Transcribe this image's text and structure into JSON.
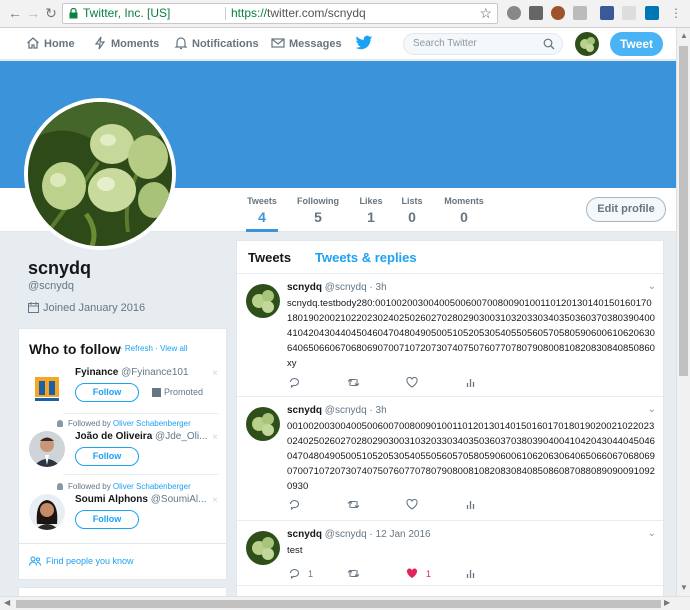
{
  "browser": {
    "secure_label": "Twitter, Inc. [US]",
    "url_https": "https://",
    "url_rest": "twitter.com/scnydq"
  },
  "nav": {
    "home": "Home",
    "moments": "Moments",
    "notifications": "Notifications",
    "messages": "Messages",
    "search_placeholder": "Search Twitter",
    "tweet_button": "Tweet"
  },
  "colors": {
    "banner": "#3b94d9",
    "accent": "#1da1f2",
    "like_active": "#e0245e"
  },
  "profile_nav": {
    "stats": [
      {
        "label": "Tweets",
        "value": "4"
      },
      {
        "label": "Following",
        "value": "5"
      },
      {
        "label": "Likes",
        "value": "1"
      },
      {
        "label": "Lists",
        "value": "0"
      },
      {
        "label": "Moments",
        "value": "0"
      }
    ],
    "edit_profile": "Edit profile"
  },
  "profile": {
    "name": "scnydq",
    "handle": "@scnydq",
    "joined": "Joined January 2016"
  },
  "who_to_follow": {
    "title": "Who to follow",
    "separator": "·",
    "refresh": "Refresh",
    "view_all": "View all",
    "suggestions": [
      {
        "name": "Fyinance",
        "handle": "@Fyinance101",
        "follow": "Follow",
        "promoted": "Promoted"
      },
      {
        "context_prefix": "Followed by",
        "context_name": "Oliver Schabenberger",
        "name": "João de Oliveira",
        "handle": "@Jde_Oli...",
        "follow": "Follow"
      },
      {
        "context_prefix": "Followed by",
        "context_name": "Oliver Schabenberger",
        "name": "Soumi Alphons",
        "handle": "@SoumiAl...",
        "follow": "Follow"
      }
    ],
    "close": "×",
    "find_people": "Find people you know"
  },
  "timeline": {
    "tabs": [
      "Tweets",
      "Tweets & replies"
    ],
    "tweets": [
      {
        "name": "scnydq",
        "handle": "@scnydq",
        "time": "3h",
        "text": "scnydq.testbody280:00100200300400500600700800901001101201301401501601701801902002102202302402502602702802903003103203303403503603703803904004104204304404504604704804905005105205305405505605705805906006106206306406506606706806907007107207307407507607707807908008108208308408508​60xy",
        "replies": "",
        "retweets": "",
        "likes": "",
        "liked": false
      },
      {
        "name": "scnydq",
        "handle": "@scnydq",
        "time": "3h",
        "text": "001002003004005006007008009010011012013014015016017018019020021022023024025026027028029030031032033034035036037038039040041042043044045046047048049050051052053054055056057058059060061062063064065066067068069070071072073074075076077078079080081082083084085086087088089090091092093​0",
        "replies": "",
        "retweets": "",
        "likes": "",
        "liked": false
      },
      {
        "name": "scnydq",
        "handle": "@scnydq",
        "time": "12 Jan 2016",
        "text": "test",
        "replies": "1",
        "retweets": "",
        "likes": "1",
        "liked": true
      }
    ]
  }
}
